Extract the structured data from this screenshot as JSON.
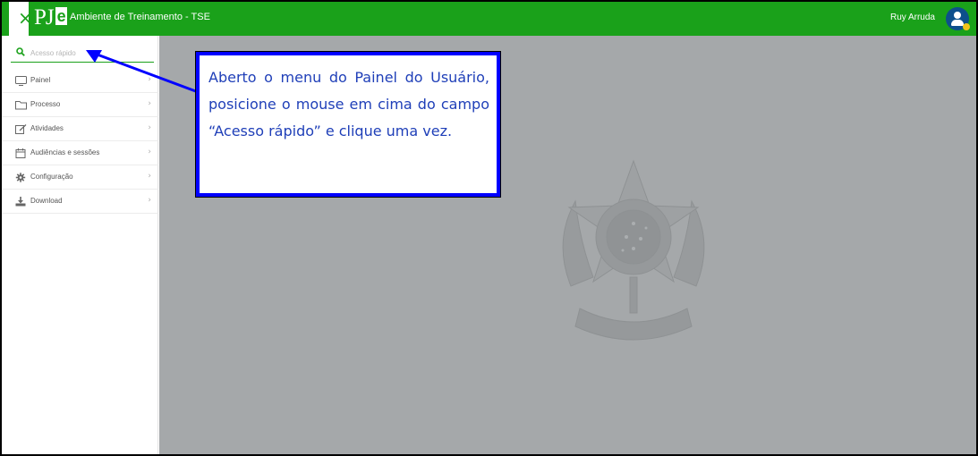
{
  "header": {
    "close_glyph": "×",
    "logo_pj": "PJ",
    "logo_e": "e",
    "app_title": "Ambiente de Treinamento - TSE",
    "user_name": "Ruy Arruda",
    "brand_color": "#1aa11a"
  },
  "sidebar": {
    "search": {
      "placeholder": "Acesso rápido",
      "value": ""
    },
    "items": [
      {
        "label": "Painel",
        "icon": "monitor-icon"
      },
      {
        "label": "Processo",
        "icon": "folder-icon"
      },
      {
        "label": "Atividades",
        "icon": "edit-icon"
      },
      {
        "label": "Audiências e sessões",
        "icon": "calendar-icon"
      },
      {
        "label": "Configuração",
        "icon": "gear-icon"
      },
      {
        "label": "Download",
        "icon": "download-icon"
      }
    ],
    "arrow_glyph": "›"
  },
  "callout": {
    "text": "Aberto o menu do Painel do Usuário, posicione o mouse em cima do campo “Acesso rápido” e clique uma vez.",
    "border_color": "#0000ff",
    "text_color": "#1f3fb8"
  },
  "content": {
    "background_color": "#a5a8aa",
    "watermark": "brazil-coat-of-arms"
  }
}
